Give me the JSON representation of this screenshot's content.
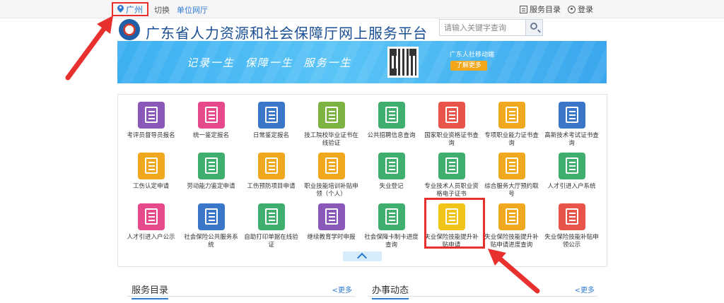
{
  "topbar": {
    "city": "广州",
    "switch_label": "切换",
    "unit_hall": "单位网厅",
    "service_directory": "服务目录",
    "login": "登录"
  },
  "header": {
    "title": "广东省人力资源和社会保障厅网上服务平台",
    "search_placeholder": "请输入关键字查询"
  },
  "banner": {
    "slogan": "记录一生 保障一生 服务一生",
    "mobile_title": "广东人社移动端",
    "learn_more": "了解更多"
  },
  "services": [
    {
      "label": "考评员督导员报名",
      "color": "#8a58b8",
      "icon": "id-card-icon"
    },
    {
      "label": "统一鉴定报名",
      "color": "#e64a8c",
      "icon": "certificate-icon"
    },
    {
      "label": "日常鉴定报名",
      "color": "#3a77c8",
      "icon": "badge-icon"
    },
    {
      "label": "技工院校毕业证书在线验证",
      "color": "#7cb342",
      "icon": "diploma-icon"
    },
    {
      "label": "公共招聘信息查询",
      "color": "#3fae6e",
      "icon": "clipboard-person-icon"
    },
    {
      "label": "国家职业资格证书查询",
      "color": "#e8534a",
      "icon": "document-icon"
    },
    {
      "label": "专项职业能力证书查询",
      "color": "#f0a81e",
      "icon": "yen-coin-icon"
    },
    {
      "label": "高新技术考试证书查询",
      "color": "#3a77c8",
      "icon": "yen-hand-icon"
    },
    {
      "label": "工伤认定申请",
      "color": "#f0a81e",
      "icon": "form-icon"
    },
    {
      "label": "劳动能力鉴定申请",
      "color": "#3fae6e",
      "icon": "people-icon"
    },
    {
      "label": "工伤预防项目申请",
      "color": "#f0a81e",
      "icon": "project-icon"
    },
    {
      "label": "职业技能培训补贴申领（个人）",
      "color": "#f0a81e",
      "icon": "training-icon"
    },
    {
      "label": "失业登记",
      "color": "#3fae6e",
      "icon": "register-icon"
    },
    {
      "label": "专业技术人员职业资格电子证书",
      "color": "#3fae6e",
      "icon": "search-doc-icon"
    },
    {
      "label": "综合服务大厅预约取号",
      "color": "#f0a81e",
      "icon": "queue-ticket-icon"
    },
    {
      "label": "人才引进入户系统",
      "color": "#3fae6e",
      "icon": "talent-icon"
    },
    {
      "label": "人才引进入户公示",
      "color": "#e64a8c",
      "icon": "money-doc-icon"
    },
    {
      "label": "社会保险公共服务系统",
      "color": "#3a77c8",
      "icon": "person-search-icon"
    },
    {
      "label": "自助打印单据在线验证",
      "color": "#3fae6e",
      "icon": "print-verify-icon"
    },
    {
      "label": "继续教育学时申报",
      "color": "#8a58b8",
      "icon": "education-icon"
    },
    {
      "label": "社会保障卡制卡进度查询",
      "color": "#3fae6e",
      "icon": "card-search-icon"
    },
    {
      "label": "失业保险技能提升补贴申请",
      "color": "#f0c419",
      "icon": "checklist-icon"
    },
    {
      "label": "失业保险技能提升补贴申请进度查询",
      "color": "#f0a81e",
      "icon": "progress-doc-icon"
    },
    {
      "label": "失业保险技能补贴申领公示",
      "color": "#e8534a",
      "icon": "announce-icon"
    }
  ],
  "sections": {
    "service_directory": {
      "title": "服务目录",
      "more": "<更多"
    },
    "news": {
      "title": "办事动态",
      "more": "<更多"
    }
  },
  "colors": {
    "annotation": "#e8312f",
    "brand_blue": "#1a4f94",
    "link_blue": "#2e7ad1"
  }
}
